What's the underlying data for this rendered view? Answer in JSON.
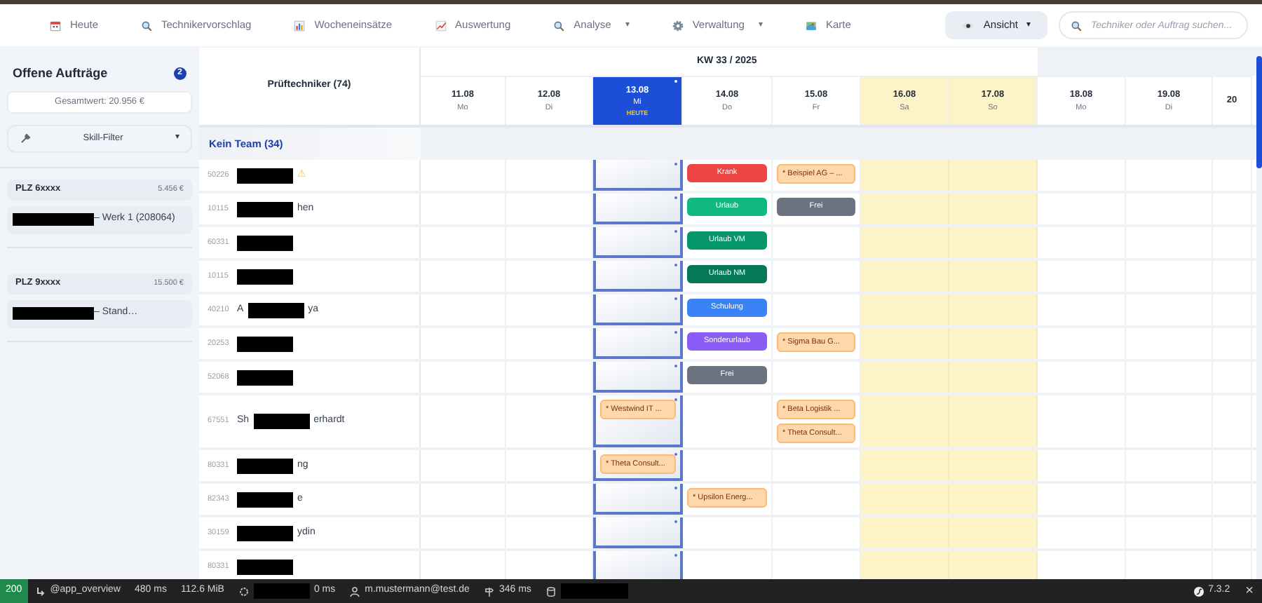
{
  "nav": {
    "items": [
      {
        "label": "Heute"
      },
      {
        "label": "Technikervorschlag"
      },
      {
        "label": "Wocheneinsätze"
      },
      {
        "label": "Auswertung"
      },
      {
        "label": "Analyse",
        "caret": "▾"
      },
      {
        "label": "Verwaltung",
        "caret": "▾"
      },
      {
        "label": "Karte"
      }
    ],
    "view_button": {
      "label": "Ansicht",
      "caret": "▾"
    },
    "search": {
      "placeholder": "Techniker oder Auftrag suchen..."
    }
  },
  "sidebar": {
    "title": "Offene Aufträge",
    "count": "2",
    "total": "Gesamtwert: 20.956 €",
    "filter": {
      "label": "Skill-Filter",
      "caret": "▾"
    },
    "groups": [
      {
        "name": "PLZ 6xxxx",
        "value": "5.456 €",
        "items": [
          {
            "text": "– Werk 1 (208064)",
            "redacted": true
          }
        ]
      },
      {
        "name": "PLZ 9xxxx",
        "value": "15.500 €",
        "items": [
          {
            "text": "– Stand…",
            "redacted": true
          }
        ]
      }
    ]
  },
  "planner": {
    "week": "KW 33 / 2025",
    "tech_header": "Prüftechniker (74)",
    "days": [
      {
        "date": "11.08",
        "weekday": "Mo",
        "selected": false,
        "weekend": false
      },
      {
        "date": "12.08",
        "weekday": "Di",
        "selected": false,
        "weekend": false
      },
      {
        "date": "13.08",
        "weekday": "Mi",
        "selected": true,
        "weekend": false,
        "badge": "HEUTE"
      },
      {
        "date": "14.08",
        "weekday": "Do",
        "selected": false,
        "weekend": false
      },
      {
        "date": "15.08",
        "weekday": "Fr",
        "selected": false,
        "weekend": false
      },
      {
        "date": "16.08",
        "weekday": "Sa",
        "selected": false,
        "weekend": true
      },
      {
        "date": "17.08",
        "weekday": "So",
        "selected": false,
        "weekend": true
      },
      {
        "date": "18.08",
        "weekday": "Mo",
        "selected": false,
        "weekend": false
      },
      {
        "date": "19.08",
        "weekday": "Di",
        "selected": false,
        "weekend": false
      },
      {
        "date": "20",
        "selected": false,
        "weekend": false
      }
    ],
    "team": "Kein Team (34)",
    "rows": [
      {
        "plz": "50226",
        "name_end": "⚠",
        "warning": true,
        "cells": [
          null,
          null,
          null,
          [
            {
              "kind": "absence",
              "label": "Krank",
              "color": "#ef4444"
            }
          ],
          [
            {
              "kind": "order",
              "label": "* Beispiel AG – ..."
            }
          ]
        ]
      },
      {
        "plz": "10115",
        "name_end": "hen",
        "cells": [
          null,
          null,
          null,
          [
            {
              "kind": "absence",
              "label": "Urlaub",
              "color": "#10b981"
            }
          ],
          [
            {
              "kind": "absence",
              "label": "Frei",
              "color": "#6b7280"
            }
          ]
        ]
      },
      {
        "plz": "60331",
        "cells": [
          null,
          null,
          null,
          [
            {
              "kind": "absence",
              "label": "Urlaub VM",
              "color": "#059669"
            }
          ]
        ]
      },
      {
        "plz": "10115",
        "cells": [
          null,
          null,
          null,
          [
            {
              "kind": "absence",
              "label": "Urlaub NM",
              "color": "#047857"
            }
          ]
        ]
      },
      {
        "plz": "40210",
        "name_start": "A",
        "name_end": "ya",
        "cells": [
          null,
          null,
          null,
          [
            {
              "kind": "absence",
              "label": "Schulung",
              "color": "#3b82f6"
            }
          ]
        ]
      },
      {
        "plz": "20253",
        "cells": [
          null,
          null,
          null,
          [
            {
              "kind": "absence",
              "label": "Sonderurlaub",
              "color": "#8b5cf6"
            }
          ],
          [
            {
              "kind": "order",
              "label": "* Sigma Bau G..."
            }
          ]
        ]
      },
      {
        "plz": "52068",
        "cells": [
          null,
          null,
          null,
          [
            {
              "kind": "absence",
              "label": "Frei",
              "color": "#6b7280"
            }
          ]
        ]
      },
      {
        "plz": "67551",
        "name_start": "Sh",
        "name_end": "erhardt",
        "cells": [
          null,
          null,
          [
            {
              "kind": "order",
              "label": "* Westwind IT ..."
            }
          ],
          null,
          [
            {
              "kind": "order",
              "label": "* Beta Logistik ..."
            },
            {
              "kind": "order",
              "label": "* Theta Consult..."
            }
          ]
        ]
      },
      {
        "plz": "80331",
        "name_end": "ng",
        "cells": [
          null,
          null,
          [
            {
              "kind": "order",
              "label": "* Theta Consult..."
            }
          ]
        ]
      },
      {
        "plz": "82343",
        "name_end": "e",
        "cells": [
          null,
          null,
          null,
          [
            {
              "kind": "order",
              "label": "* Upsilon Energ..."
            }
          ]
        ]
      },
      {
        "plz": "30159",
        "name_end": "ydin"
      },
      {
        "plz": "80331"
      }
    ]
  },
  "status_bar": {
    "code": "200",
    "route": "@app_overview",
    "time": "480 ms",
    "memory": "112.6 MiB",
    "cache_time": "0 ms",
    "user": "m.mustermann@test.de",
    "requests": "346 ms",
    "version": "7.3.2",
    "close": "×"
  }
}
